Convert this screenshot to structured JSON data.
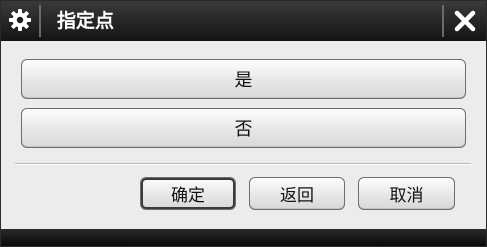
{
  "window": {
    "title": "指定点",
    "title_icon": "gear-icon",
    "close_icon": "close-icon",
    "colors": {
      "titlebar": "#1c1c1c",
      "face": "#ececec",
      "button": "#e6e6e6"
    }
  },
  "options": {
    "yes_label": "是",
    "no_label": "否"
  },
  "footer": {
    "ok_label": "确定",
    "back_label": "返回",
    "cancel_label": "取消"
  }
}
